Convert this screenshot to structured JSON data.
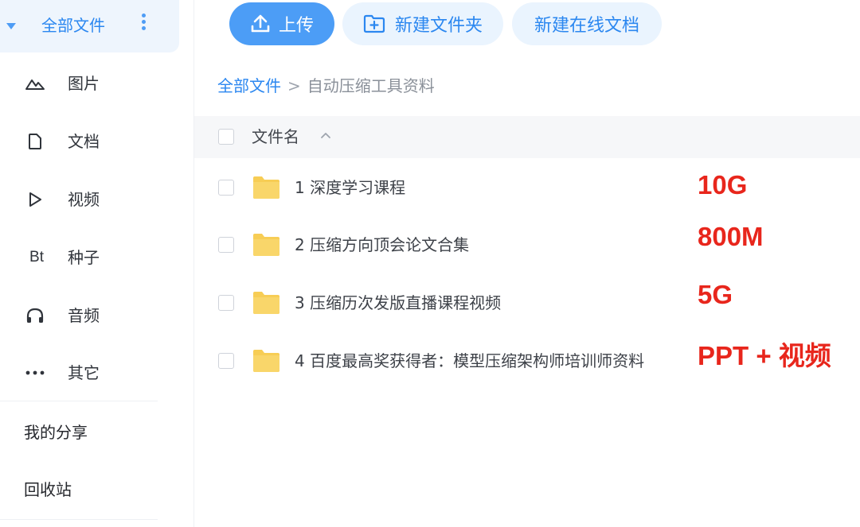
{
  "sidebar": {
    "all_files": "全部文件",
    "items": [
      {
        "label": "图片",
        "icon": "image-icon"
      },
      {
        "label": "文档",
        "icon": "document-icon"
      },
      {
        "label": "视频",
        "icon": "video-icon"
      },
      {
        "label": "种子",
        "icon": "bt-torrent-icon"
      },
      {
        "label": "音频",
        "icon": "headphones-icon"
      },
      {
        "label": "其它",
        "icon": "more-icon"
      }
    ],
    "bt_text": "Bt",
    "my_share": "我的分享",
    "recycle_bin": "回收站"
  },
  "toolbar": {
    "upload": "上传",
    "new_folder": "新建文件夹",
    "new_online_doc": "新建在线文档"
  },
  "breadcrumb": {
    "root": "全部文件",
    "separator": ">",
    "current": "自动压缩工具资料"
  },
  "table": {
    "column_name": "文件名",
    "rows": [
      {
        "name": "1 深度学习课程"
      },
      {
        "name": "2 压缩方向顶会论文合集"
      },
      {
        "name": "3 压缩历次发版直播课程视频"
      },
      {
        "name": "4 百度最高奖获得者：模型压缩架构师培训师资料"
      }
    ]
  },
  "annotations": [
    "10G",
    "800M",
    "5G",
    "PPT + 视频"
  ],
  "colors": {
    "accent": "#2b87f0",
    "upload_button": "#4c9df6",
    "folder": "#f7cd55",
    "annotation": "#e8261c"
  }
}
